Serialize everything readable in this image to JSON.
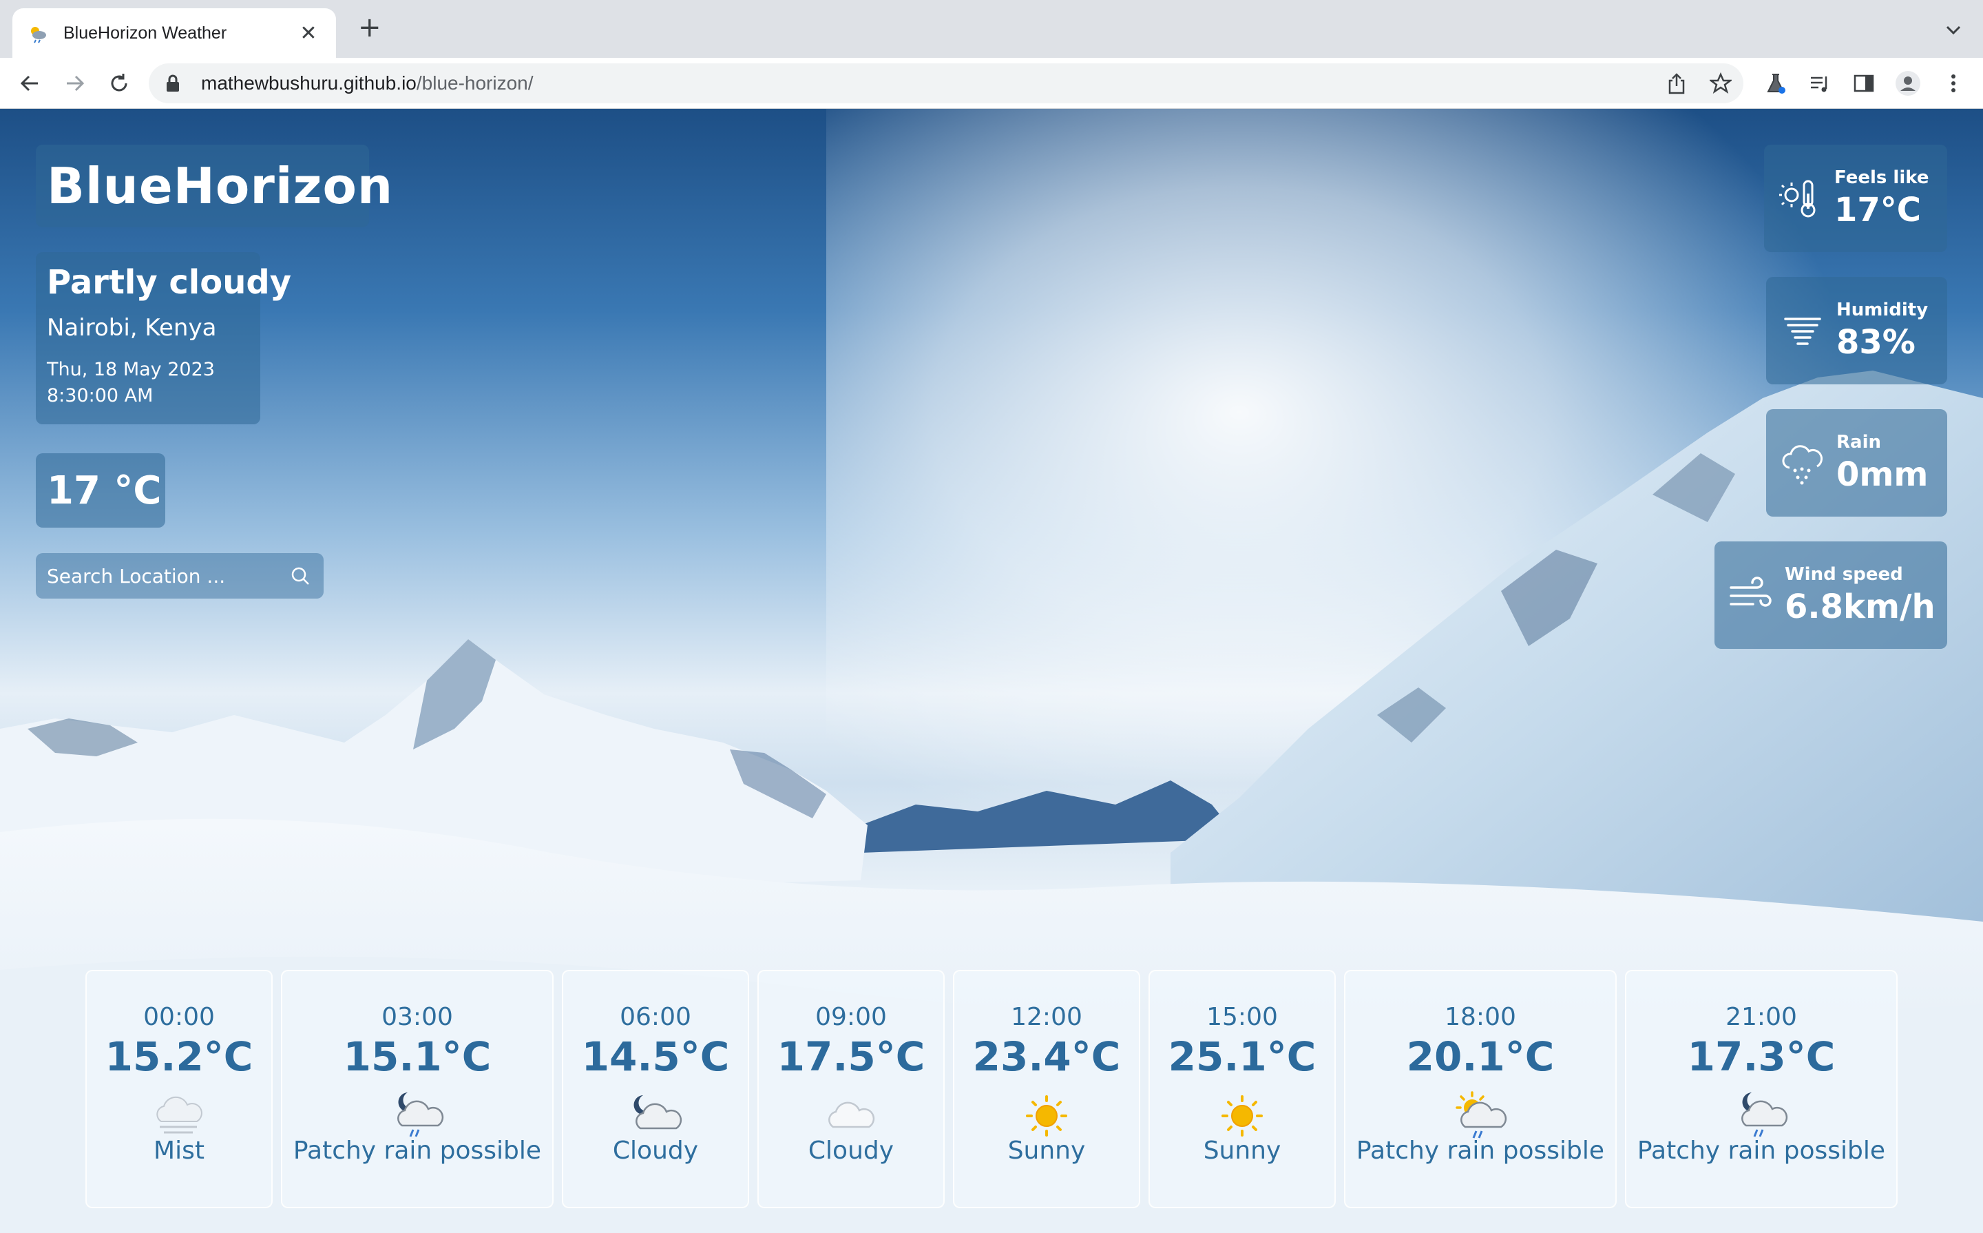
{
  "browser": {
    "tab_title": "BlueHorizon Weather",
    "url_host": "mathewbushuru.github.io",
    "url_path": "/blue-horizon/"
  },
  "app": {
    "brand": "BlueHorizon",
    "condition": "Partly cloudy",
    "location": "Nairobi, Kenya",
    "date": "Thu, 18 May 2023",
    "time": "8:30:00 AM",
    "temperature": "17 °C",
    "search_placeholder": "Search Location ..."
  },
  "stats": {
    "feels_like": {
      "label": "Feels like",
      "value": "17°C",
      "icon": "thermometer-sun-icon"
    },
    "humidity": {
      "label": "Humidity",
      "value": "83%",
      "icon": "humidity-icon"
    },
    "rain": {
      "label": "Rain",
      "value": "0mm",
      "icon": "rain-cloud-icon"
    },
    "wind": {
      "label": "Wind speed",
      "value": "6.8km/h",
      "icon": "wind-icon"
    }
  },
  "hourly": [
    {
      "hour": "00:00",
      "temp": "15.2°C",
      "condition": "Mist",
      "icon": "mist-icon"
    },
    {
      "hour": "03:00",
      "temp": "15.1°C",
      "condition": "Patchy rain possible",
      "icon": "night-rain-icon"
    },
    {
      "hour": "06:00",
      "temp": "14.5°C",
      "condition": "Cloudy",
      "icon": "night-cloud-icon"
    },
    {
      "hour": "09:00",
      "temp": "17.5°C",
      "condition": "Cloudy",
      "icon": "cloud-icon"
    },
    {
      "hour": "12:00",
      "temp": "23.4°C",
      "condition": "Sunny",
      "icon": "sun-icon"
    },
    {
      "hour": "15:00",
      "temp": "25.1°C",
      "condition": "Sunny",
      "icon": "sun-icon"
    },
    {
      "hour": "18:00",
      "temp": "20.1°C",
      "condition": "Patchy rain possible",
      "icon": "sun-rain-icon"
    },
    {
      "hour": "21:00",
      "temp": "17.3°C",
      "condition": "Patchy rain possible",
      "icon": "night-rain-icon"
    }
  ],
  "colors": {
    "panel": "#306896",
    "card_text": "#2c6a9c",
    "sun": "#f5b800"
  }
}
